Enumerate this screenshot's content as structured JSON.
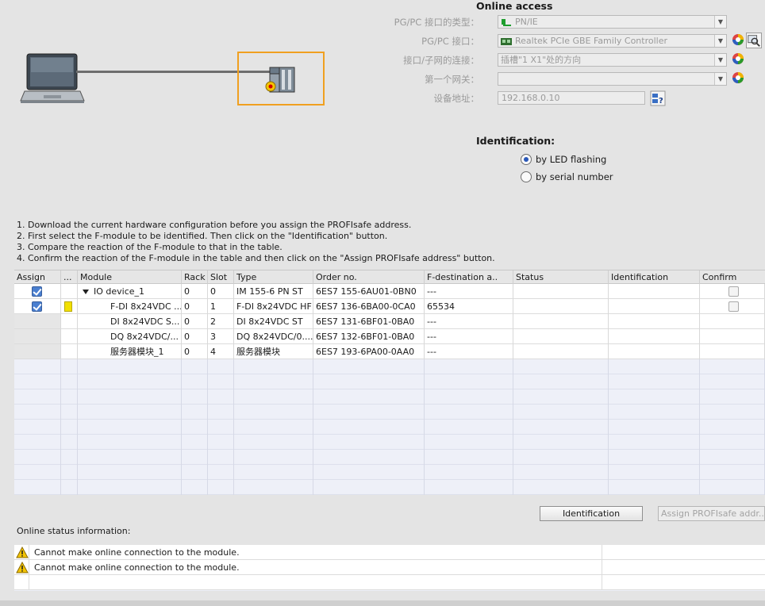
{
  "online_access": {
    "title": "Online access",
    "pgpc_type_label": "PG/PC 接口的类型：",
    "pgpc_type_value": "PN/IE",
    "pgpc_if_label": "PG/PC 接口：",
    "pgpc_if_value": "Realtek PCIe GBE Family Controller",
    "subnet_label": "接口/子网的连接：",
    "subnet_value": "插槽\"1 X1\"处的方向",
    "gateway_label": "第一个网关：",
    "gateway_value": "",
    "address_label": "设备地址：",
    "address_value": "192.168.0.10"
  },
  "identification": {
    "title": "Identification:",
    "options": [
      {
        "label": "by LED flashing",
        "selected": true
      },
      {
        "label": "by serial number",
        "selected": false
      }
    ]
  },
  "instructions": [
    "1. Download the current hardware configuration before you assign the PROFIsafe address.",
    "2. First select the F-module to be identified. Then click on the \"Identification\" button.",
    "3. Compare the reaction of the F-module to that in the table.",
    "4. Confirm the reaction of the F-module in the table and then click on the \"Assign PROFIsafe address\" button."
  ],
  "table": {
    "headers": [
      "Assign",
      "...",
      "Module",
      "Rack",
      "Slot",
      "Type",
      "Order no.",
      "F-destination a..",
      "Status",
      "Identification",
      "Confirm"
    ],
    "rows": [
      {
        "assign": true,
        "flag": false,
        "module": "IO device_1",
        "expanded": true,
        "rack": "0",
        "slot": "0",
        "type": "IM 155-6 PN ST",
        "order": "6ES7 155-6AU01-0BN0",
        "fdest": "---",
        "status": "",
        "ident": "",
        "confirm": "empty"
      },
      {
        "assign": true,
        "flag": true,
        "module": "F-DI 8x24VDC ...",
        "expanded": false,
        "rack": "0",
        "slot": "1",
        "type": "F-DI 8x24VDC HF",
        "order": "6ES7 136-6BA00-0CA0",
        "fdest": "65534",
        "status": "",
        "ident": "",
        "confirm": "empty"
      },
      {
        "assign": null,
        "flag": false,
        "module": "DI 8x24VDC S...",
        "expanded": false,
        "rack": "0",
        "slot": "2",
        "type": "DI 8x24VDC ST",
        "order": "6ES7 131-6BF01-0BA0",
        "fdest": "---",
        "status": "",
        "ident": "",
        "confirm": "none"
      },
      {
        "assign": null,
        "flag": false,
        "module": "DQ 8x24VDC/...",
        "expanded": false,
        "rack": "0",
        "slot": "3",
        "type": "DQ 8x24VDC/0....",
        "order": "6ES7 132-6BF01-0BA0",
        "fdest": "---",
        "status": "",
        "ident": "",
        "confirm": "none"
      },
      {
        "assign": null,
        "flag": false,
        "module": "服务器模块_1",
        "expanded": false,
        "rack": "0",
        "slot": "4",
        "type": "服务器模块",
        "order": "6ES7 193-6PA00-0AA0",
        "fdest": "---",
        "status": "",
        "ident": "",
        "confirm": "none"
      }
    ]
  },
  "buttons": {
    "identification": "Identification",
    "assign": "Assign PROFIsafe addr..."
  },
  "status": {
    "title": "Online status information:",
    "messages": [
      "Cannot make online connection to the module.",
      "Cannot make online connection to the module."
    ]
  }
}
